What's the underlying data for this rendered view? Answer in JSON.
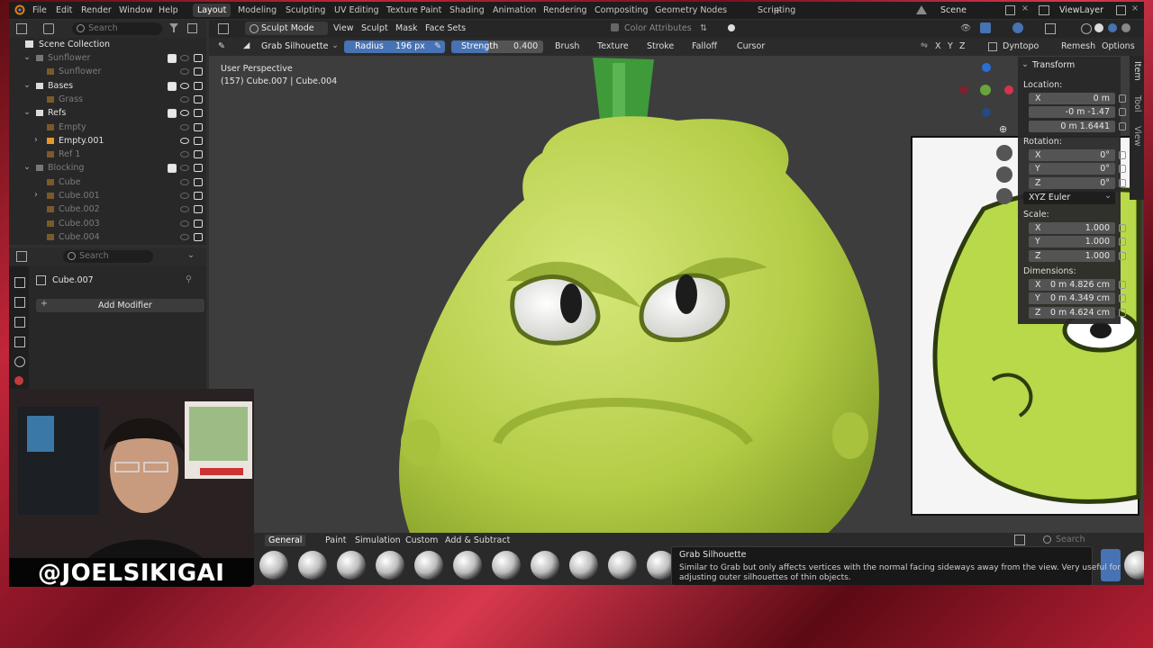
{
  "topbar": {
    "menus": [
      "File",
      "Edit",
      "Render",
      "Window",
      "Help"
    ],
    "workspaces": [
      "Layout",
      "Modeling",
      "Sculpting",
      "UV Editing",
      "Texture Paint",
      "Shading",
      "Animation",
      "Rendering",
      "Compositing",
      "Geometry Nodes",
      "Scripting"
    ],
    "active_workspace": "Layout",
    "scene": "Scene",
    "view_layer": "ViewLayer"
  },
  "outliner": {
    "search_placeholder": "Search",
    "root": "Scene Collection",
    "rows": [
      {
        "label": "Sunflower",
        "dim": true
      },
      {
        "label": "Sunflower",
        "dim": true
      },
      {
        "label": "Bases",
        "dim": false
      },
      {
        "label": "Grass",
        "dim": true
      },
      {
        "label": "Refs",
        "dim": false
      },
      {
        "label": "Empty",
        "dim": true
      },
      {
        "label": "Empty.001",
        "dim": false
      },
      {
        "label": "Ref 1",
        "dim": true
      },
      {
        "label": "Blocking",
        "dim": true
      },
      {
        "label": "Cube",
        "dim": true
      },
      {
        "label": "Cube.001",
        "dim": true
      },
      {
        "label": "Cube.002",
        "dim": true
      },
      {
        "label": "Cube.003",
        "dim": true
      },
      {
        "label": "Cube.004",
        "dim": true
      }
    ]
  },
  "properties": {
    "search_placeholder": "Search",
    "object_name": "Cube.007",
    "add_modifier": "Add Modifier"
  },
  "viewport": {
    "mode": "Sculpt Mode",
    "menus": [
      "View",
      "Sculpt",
      "Mask",
      "Face Sets"
    ],
    "color_attributes": "Color Attributes",
    "brush": "Grab Silhouette",
    "radius_label": "Radius",
    "radius_value": "196 px",
    "strength_label": "Strength",
    "strength_value": "0.400",
    "tool_menus": [
      "Brush",
      "Texture",
      "Stroke",
      "Falloff",
      "Cursor"
    ],
    "axes": [
      "X",
      "Y",
      "Z"
    ],
    "dyntopo": "Dyntopo",
    "remesh": "Remesh",
    "options": "Options",
    "perspective": "User Perspective",
    "object_info": "(157) Cube.007 | Cube.004"
  },
  "npanel": {
    "title": "Transform",
    "location_label": "Location:",
    "location": [
      {
        "axis": "X",
        "value": "0 m"
      },
      {
        "axis": "",
        "value": "-0 m -1.47"
      },
      {
        "axis": "",
        "value": "0 m 1.6441"
      }
    ],
    "rotation_label": "Rotation:",
    "rotation": [
      {
        "axis": "X",
        "value": "0°"
      },
      {
        "axis": "Y",
        "value": "0°"
      },
      {
        "axis": "Z",
        "value": "0°"
      }
    ],
    "rotation_mode": "XYZ Euler",
    "scale_label": "Scale:",
    "scale": [
      {
        "axis": "X",
        "value": "1.000"
      },
      {
        "axis": "Y",
        "value": "1.000"
      },
      {
        "axis": "Z",
        "value": "1.000"
      }
    ],
    "dimensions_label": "Dimensions:",
    "dimensions": [
      {
        "axis": "X",
        "value": "0 m 4.826 cm"
      },
      {
        "axis": "Y",
        "value": "0 m 4.349 cm"
      },
      {
        "axis": "Z",
        "value": "0 m 4.624 cm"
      }
    ],
    "tabs": [
      "Item",
      "Tool",
      "View"
    ]
  },
  "shelf": {
    "tabs": [
      "General",
      "Paint",
      "Simulation",
      "Custom",
      "Add & Subtract"
    ],
    "active_tab": "General",
    "search_placeholder": "Search"
  },
  "tooltip": {
    "title": "Grab Silhouette",
    "body_line1": "Similar to Grab but only affects vertices with the normal facing sideways away from the view. Very useful for",
    "body_line2": "adjusting outer silhouettes of thin objects."
  },
  "webcam": {
    "handle": "@JOELSIKIGAI"
  },
  "colors": {
    "accent": "#4772b3",
    "squash": "#b8d24a",
    "background_red": "#c2263a"
  }
}
